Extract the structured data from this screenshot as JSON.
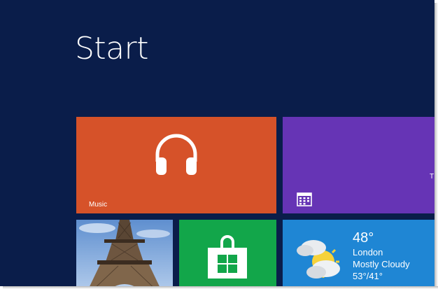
{
  "start": {
    "title": "Start"
  },
  "tiles": {
    "music": {
      "label": "Music",
      "color": "#d65229",
      "icon": "headphones-icon"
    },
    "calendar": {
      "peek": "T",
      "color": "#6634b5",
      "icon": "calendar-icon"
    },
    "photos": {
      "icon": "eiffel-tower-photo"
    },
    "store": {
      "color": "#12a64a",
      "icon": "store-bag-icon"
    },
    "weather": {
      "temperature": "48°",
      "city": "London",
      "condition": "Mostly Cloudy",
      "range": "53°/41°",
      "color": "#1f86d4",
      "icon": "partly-cloudy-icon"
    }
  },
  "colors": {
    "background": "#0a1d4a"
  }
}
